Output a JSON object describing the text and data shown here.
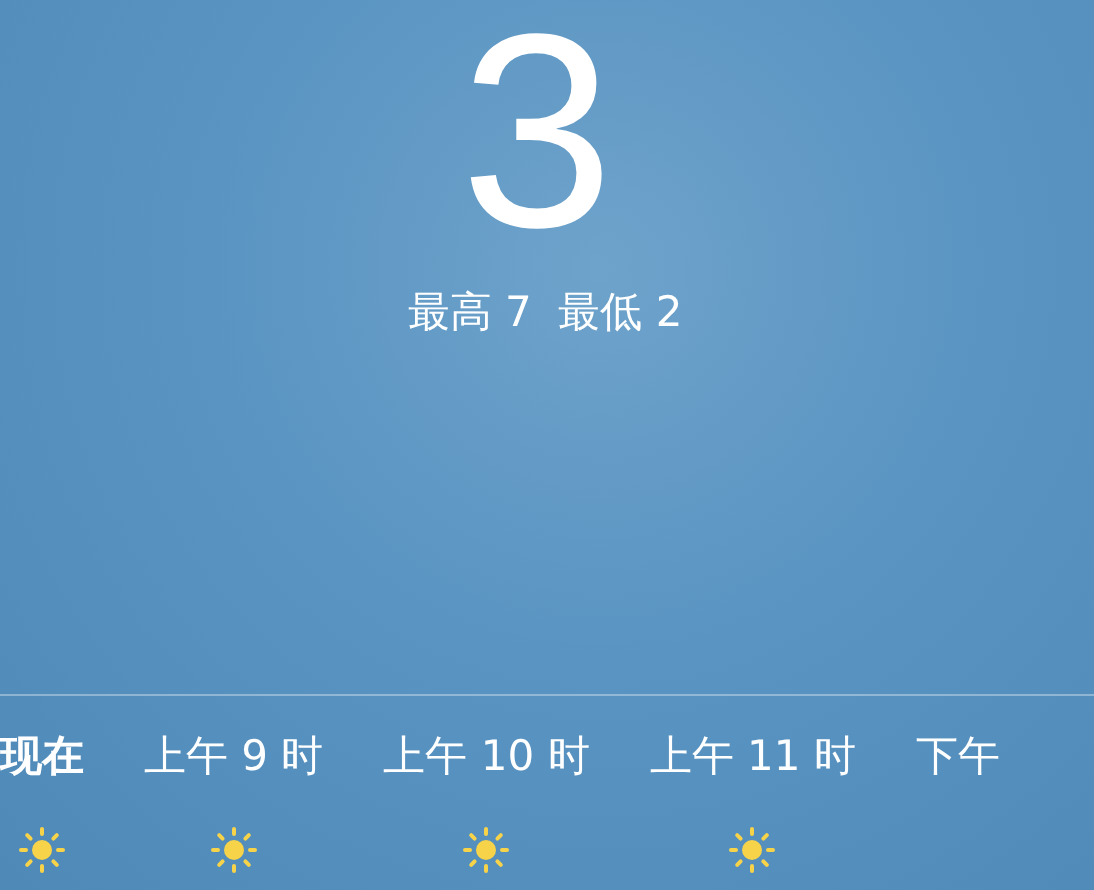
{
  "current": {
    "temperature": "3",
    "high_low": "最高 7  最低 2"
  },
  "hourly": [
    {
      "kind": "sunny",
      "label": "现在",
      "selected": true
    },
    {
      "kind": "sunny",
      "label": "上午 9 时",
      "selected": false
    },
    {
      "kind": "sunny",
      "label": "上午 10 时",
      "selected": false
    },
    {
      "kind": "sunny",
      "label": "上午 11 时",
      "selected": false
    },
    {
      "kind": "label_only",
      "label": "下午",
      "selected": false
    }
  ]
}
